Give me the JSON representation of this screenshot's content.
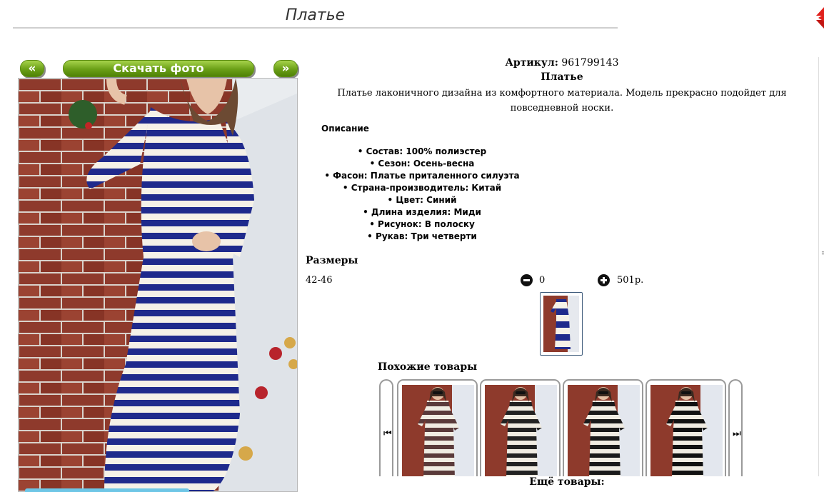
{
  "header": {
    "title": "Платье",
    "close_icon": "close-icon"
  },
  "photo_nav": {
    "prev_label": "«",
    "download_label": "Скачать фото",
    "next_label": "»"
  },
  "product": {
    "article_label": "Артикул:",
    "article_value": "961799143",
    "name": "Платье",
    "description": "Платье лаконичного дизайна из комфортного материала. Модель прекрасно подойдет для повседневной носки.",
    "description_heading": "Описание",
    "features": [
      "• Состав: 100% полиэстер",
      "• Сезон: Осень-весна",
      "• Фасон: Платье приталенного силуэта",
      "• Страна-производитель: Китай",
      "• Цвет: Синий",
      "• Длина изделия: Миди",
      "• Рисунок: В полоску",
      "• Рукав: Три четверти"
    ]
  },
  "sizes": {
    "heading": "Размеры",
    "rows": [
      {
        "size": "42-46",
        "quantity": "0",
        "price": "501р."
      }
    ]
  },
  "similar": {
    "heading": "Похожие товары",
    "prev_icon": "skip-prev-icon",
    "next_icon": "skip-next-icon",
    "items": [
      {
        "stripe_color": "#5a3a3a"
      },
      {
        "stripe_color": "#222222"
      },
      {
        "stripe_color": "#1a1a1a"
      },
      {
        "stripe_color": "#111111"
      }
    ]
  },
  "more_label": "Ещё товары:",
  "colors": {
    "button_green": "#6a9f16",
    "dress_stripe": "#1f2a8c"
  }
}
